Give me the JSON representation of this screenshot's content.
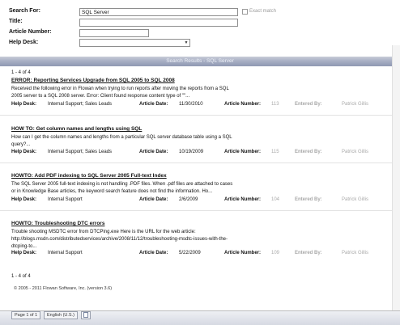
{
  "search": {
    "search_for_label": "Search For:",
    "search_for_value": "SQL Server",
    "exact_match_label": "Exact match",
    "title_label": "Title:",
    "title_value": "",
    "article_number_label": "Article Number:",
    "article_number_value": "",
    "help_desk_label": "Help Desk:",
    "help_desk_value": ""
  },
  "results_bar": {
    "title": "Search Results - SQL Server"
  },
  "pager": {
    "top": "1 - 4 of 4",
    "bottom": "1 - 4 of 4"
  },
  "labels": {
    "help_desk": "Help Desk:",
    "article_date": "Article Date:",
    "article_number": "Article Number:",
    "entered_by": "Entered By:"
  },
  "results": [
    {
      "title": "ERROR: Reporting Services Upgrade from SQL 2005 to SQL 2008",
      "description": "Received the following error in Flowan when trying to run reports after moving the reports from a SQL 2005 server to a SQL 2008 server. Error: Client found response content type of \"\"...",
      "help_desk": "Internal Support; Sales Leads",
      "article_date": "11/30/2010",
      "article_number": "113",
      "entered_by": "Patrick Gillis"
    },
    {
      "title": "HOW TO: Get column names and lengths using SQL",
      "description": "How can I get the column names and lengths from a particular SQL server database table using a SQL query?...",
      "help_desk": "Internal Support; Sales Leads",
      "article_date": "10/19/2009",
      "article_number": "115",
      "entered_by": "Patrick Gillis"
    },
    {
      "title": "HOWTO: Add PDF indexing to SQL Server 2005 Full-text Index",
      "description": "The SQL Server 2005 full-text indexing is not handling .PDF files. When .pdf files are attached to cases or in Knowledge Base articles, the keyword search feature does not find the information. Ho...",
      "help_desk": "Internal Support",
      "article_date": "2/6/2009",
      "article_number": "104",
      "entered_by": "Patrick Gillis"
    },
    {
      "title": "HOWTO: Troubleshooting DTC errors",
      "description": "Trouble shooting MSDTC error from DTCPing.exe Here is the URL for the web article: http://blogs.msdn.com/distributedservices/archive/2008/11/12/troubleshooting-msdtc-issues-with-the-dtcping-to...",
      "help_desk": "Internal Support",
      "article_date": "5/22/2009",
      "article_number": "109",
      "entered_by": "Patrick Gillis"
    }
  ],
  "footer": {
    "copyright": "© 2005 - 2011 Flowan Software, Inc. (version 3.6)"
  },
  "statusbar": {
    "page": "Page 1 of 1",
    "language": "English (U.S.)"
  }
}
